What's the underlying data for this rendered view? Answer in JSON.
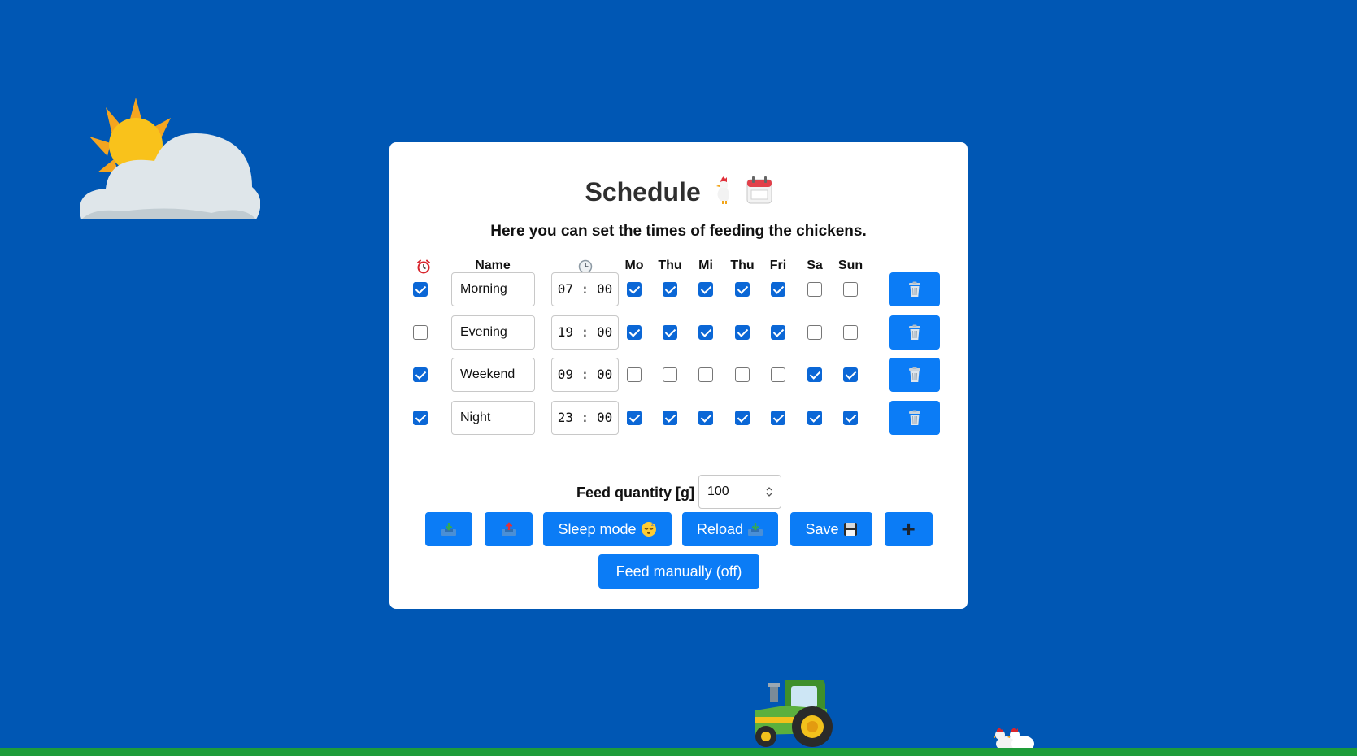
{
  "card": {
    "title": "Schedule",
    "subtitle": "Here you can set the times of feeding the chickens."
  },
  "table": {
    "headers": {
      "enabled_icon": "alarm-clock-icon",
      "name": "Name",
      "time_icon": "clock-icon",
      "days": [
        "Mo",
        "Thu",
        "Mi",
        "Thu",
        "Fri",
        "Sa",
        "Sun"
      ]
    },
    "rows": [
      {
        "enabled": true,
        "name": "Morning",
        "hour": "07",
        "minute": "00",
        "days": [
          true,
          true,
          true,
          true,
          true,
          false,
          false
        ]
      },
      {
        "enabled": false,
        "name": "Evening",
        "hour": "19",
        "minute": "00",
        "days": [
          true,
          true,
          true,
          true,
          true,
          false,
          false
        ]
      },
      {
        "enabled": true,
        "name": "Weekend",
        "hour": "09",
        "minute": "00",
        "days": [
          false,
          false,
          false,
          false,
          false,
          true,
          true
        ]
      },
      {
        "enabled": true,
        "name": "Night",
        "hour": "23",
        "minute": "00",
        "days": [
          true,
          true,
          true,
          true,
          true,
          true,
          true
        ]
      }
    ],
    "delete_icon": "trash-icon"
  },
  "feed_quantity": {
    "label": "Feed quantity [g]",
    "value": "100"
  },
  "buttons": {
    "download_icon": "download-tray-icon",
    "upload_icon": "upload-tray-icon",
    "sleep_label": "Sleep mode",
    "reload_label": "Reload",
    "save_label": "Save",
    "add_label": "+",
    "feed_manually_label": "Feed manually (off)"
  },
  "colors": {
    "background": "#0057b4",
    "ground": "#1e9c3a",
    "card": "#ffffff",
    "button": "#0b7cf6",
    "checkbox_checked": "#0b67d6"
  },
  "decor": {
    "weather_icon": "sun-behind-cloud-icon",
    "vehicle_icon": "tractor-icon",
    "animals_icon": "chickens-icon"
  }
}
